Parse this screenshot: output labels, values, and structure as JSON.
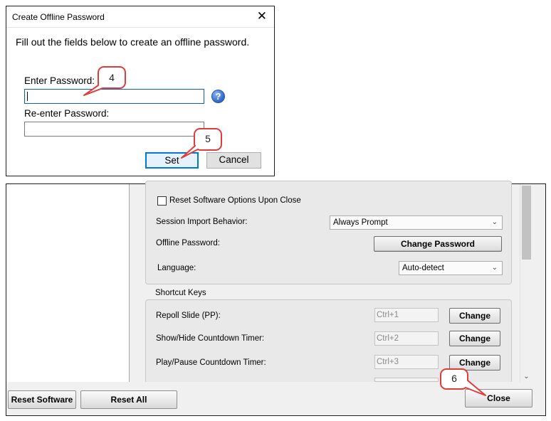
{
  "dialog": {
    "title": "Create Offline Password",
    "instruction": "Fill out the fields below to create an offline password.",
    "enter_label": "Enter Password:",
    "enter_value": "",
    "reenter_label": "Re-enter Password:",
    "reenter_value": "",
    "help_glyph": "?",
    "set_label": "Set",
    "cancel_label": "Cancel",
    "close_glyph": "✕"
  },
  "callouts": {
    "step4": "4",
    "step5": "5",
    "step6": "6",
    "border_color": "#e03c3c"
  },
  "options": {
    "reset_checkbox_label": "Reset Software Options Upon Close",
    "reset_checked": false,
    "session_import_label": "Session Import Behavior:",
    "session_import_value": "Always Prompt",
    "offline_password_label": "Offline Password:",
    "change_password_label": "Change Password",
    "language_label": "Language:",
    "language_value": "Auto-detect"
  },
  "shortcuts": {
    "section_title": "Shortcut Keys",
    "change_label": "Change",
    "items": [
      {
        "label": "Repoll Slide (PP):",
        "key": "Ctrl+1"
      },
      {
        "label": "Show/Hide Countdown Timer:",
        "key": "Ctrl+2"
      },
      {
        "label": "Play/Pause Countdown Timer:",
        "key": "Ctrl+3"
      }
    ]
  },
  "footer": {
    "reset_software_label": "Reset Software",
    "reset_all_label": "Reset All",
    "close_label": "Close"
  }
}
